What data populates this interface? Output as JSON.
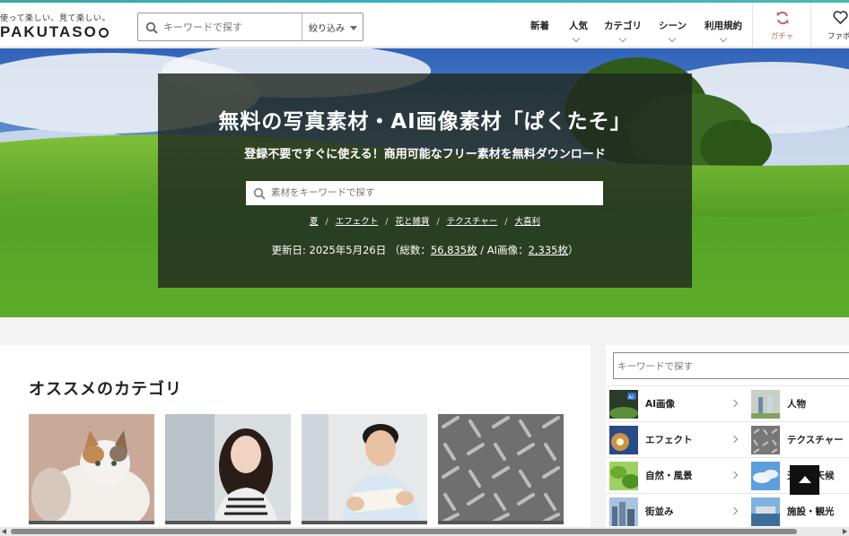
{
  "header": {
    "tagline": "使って楽しい、見て楽しい。",
    "logo": "PAKUTASO",
    "search_placeholder": "キーワードで探す",
    "filter_label": "絞り込み",
    "nav": [
      "新着",
      "人気",
      "カテゴリ",
      "シーン",
      "利用規約"
    ],
    "gacha_label": "ガチャ",
    "favorites_label": "ファボ",
    "accent_color": "#3aa9a0"
  },
  "hero": {
    "title": "無料の写真素材・AI画像素材「ぱくたそ」",
    "subtitle": "登録不要ですぐに使える！商用可能なフリー素材を無料ダウンロード",
    "search_placeholder": "素材をキーワードで探す",
    "tags": [
      "夏",
      "エフェクト",
      "花と雑貨",
      "テクスチャー",
      "大喜利"
    ],
    "updated_prefix": "更新日: 2025年5月26日 （総数：",
    "total_count": "56,835枚",
    "ai_prefix": " / AI画像：",
    "ai_count": "2,335枚",
    "suffix": "）"
  },
  "recommended": {
    "heading": "オススメのカテゴリ"
  },
  "sidebar": {
    "search_placeholder": "キーワードで探す",
    "categories": [
      "AI画像",
      "人物",
      "エフェクト",
      "テクスチャー",
      "自然・風景",
      "天気・天候",
      "街並み",
      "施設・観光"
    ]
  },
  "icons": [
    "search-icon",
    "gacha-refresh-icon",
    "heart-icon",
    "chevron-down-icon",
    "chevron-right-icon",
    "back-to-top-icon"
  ]
}
